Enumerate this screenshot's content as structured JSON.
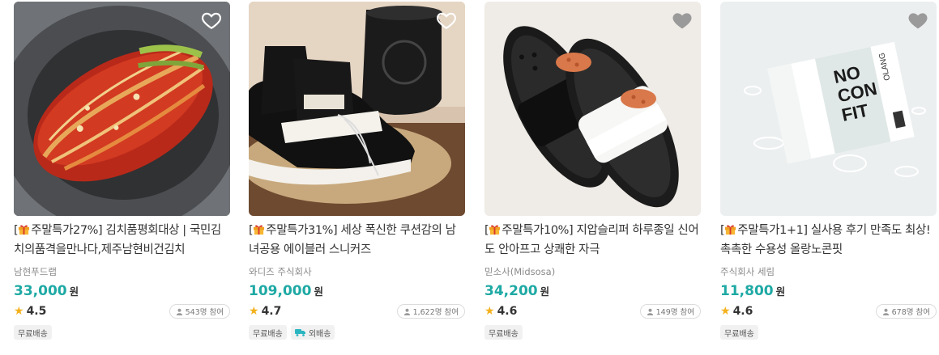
{
  "colors": {
    "price": "#1ea9a4",
    "star": "#f3b11d",
    "heart": "#ffffff"
  },
  "products": [
    {
      "title_prefix": "[",
      "title_badge": "주말특가27%]",
      "title_rest": " 김치품평회대상 | 국민김치의품격을만나다,제주남현비건김치",
      "seller": "남현푸드랩",
      "price": "33,000",
      "currency": "원",
      "rating": "4.5",
      "participants": "543명 참여",
      "tags": [
        "무료배송"
      ],
      "image": "kimchi-photo"
    },
    {
      "title_prefix": "[",
      "title_badge": "주말특가31%]",
      "title_rest": " 세상 폭신한 쿠션감의 남녀공용 에이블러 스니커즈",
      "seller": "와디즈 주식회사",
      "price": "109,000",
      "currency": "원",
      "rating": "4.7",
      "participants": "1,622명 참여",
      "tags": [
        "무료배송",
        "외배송"
      ],
      "image": "sneaker-photo"
    },
    {
      "title_prefix": "[",
      "title_badge": "주말특가10%]",
      "title_rest": " 지압슬리퍼 하루종일 신어도 안아프고 상쾌한 자극",
      "seller": "믿소사(Midsosa)",
      "price": "34,200",
      "currency": "원",
      "rating": "4.6",
      "participants": "149명 참여",
      "tags": [
        "무료배송"
      ],
      "image": "slipper-photo"
    },
    {
      "title_prefix": "[",
      "title_badge": "주말특가1+1]",
      "title_rest": " 실사용 후기 만족도 최상! 촉촉한 수용성 올랑노콘핏",
      "seller": "주식회사 세림",
      "price": "11,800",
      "currency": "원",
      "rating": "4.6",
      "participants": "678명 참여",
      "tags": [
        "무료배송"
      ],
      "image": "cosmetic-box-photo",
      "box_text": "NO CON FIT",
      "box_brand": "OLANG"
    }
  ]
}
